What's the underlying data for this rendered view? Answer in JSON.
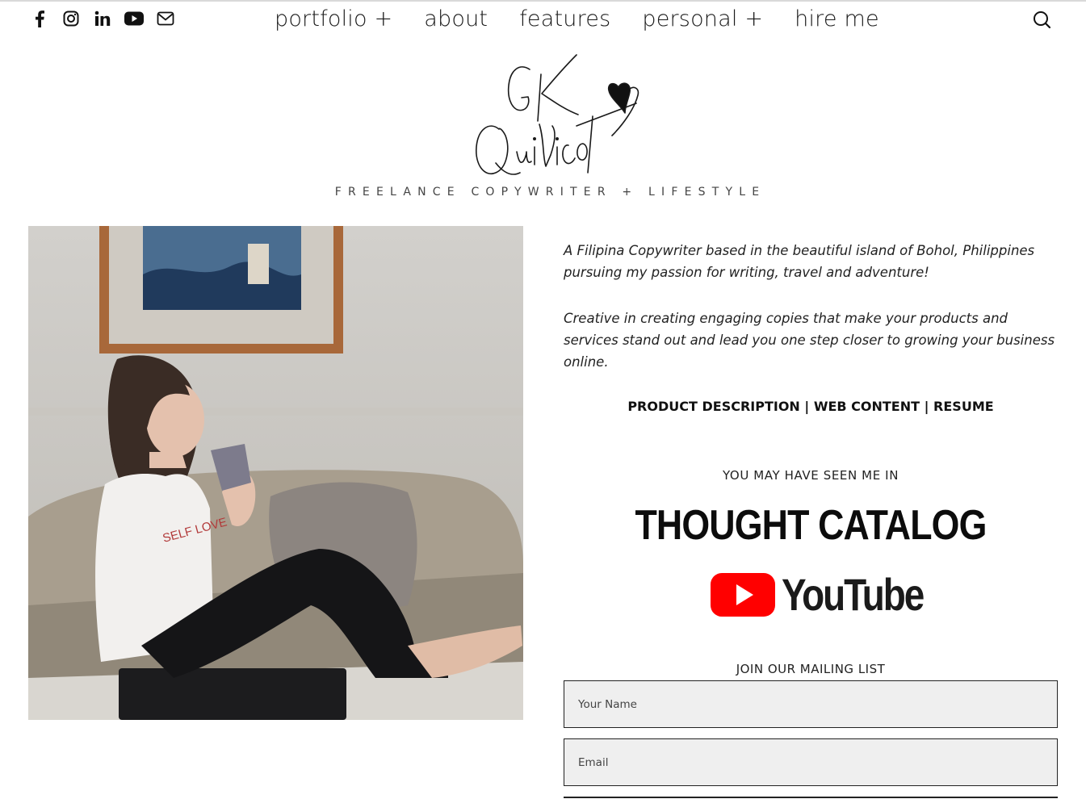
{
  "social": [
    "facebook-icon",
    "instagram-icon",
    "linkedin-icon",
    "youtube-icon",
    "mail-icon"
  ],
  "nav": {
    "items": [
      "portfolio +",
      "about",
      "features",
      "personal +",
      "hire me"
    ]
  },
  "brand": {
    "logo_text": "GK Quilicot",
    "tagline": "FREELANCE COPYWRITER + LIFESTYLE"
  },
  "intro": {
    "p1": "A Filipina Copywriter based in the beautiful island of Bohol, Philippines pursuing my passion for writing, travel and adventure!",
    "p2": "Creative in creating engaging copies that make your products and services stand out and lead you one step closer to growing your business online."
  },
  "links": {
    "product_description": "PRODUCT DESCRIPTION",
    "web_content": "WEB CONTENT",
    "resume": "RESUME",
    "separator": "|"
  },
  "featured": {
    "heading": "YOU MAY HAVE SEEN ME IN",
    "thought_catalog": "THOUGHT CATALOG",
    "youtube": "YouTube"
  },
  "mailing": {
    "heading": "JOIN OUR MAILING LIST",
    "name_placeholder": "Your Name",
    "email_placeholder": "Email"
  },
  "colors": {
    "youtube_red": "#ff0000",
    "text": "#111111",
    "field_bg": "#efefef"
  }
}
